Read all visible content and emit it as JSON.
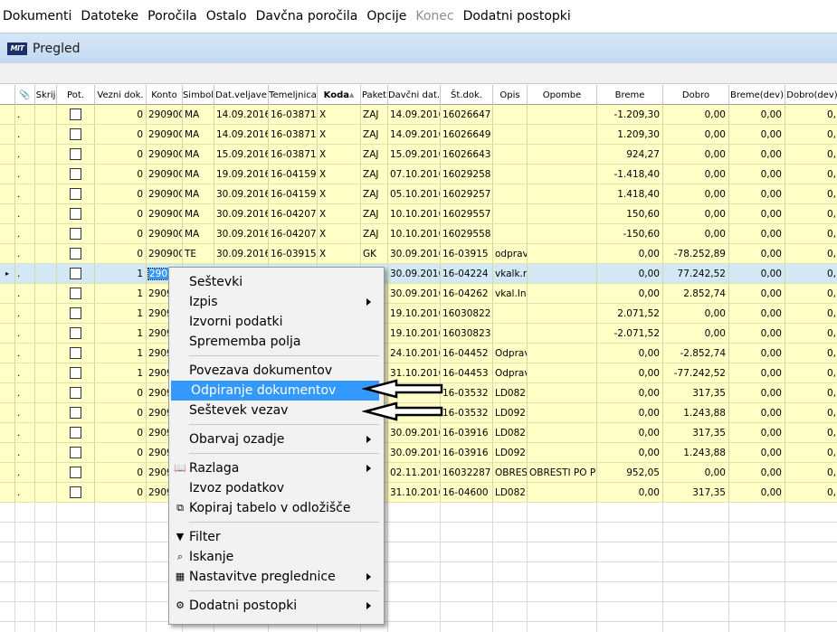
{
  "menubar": {
    "items": [
      {
        "label": "Dokumenti",
        "disabled": false
      },
      {
        "label": "Datoteke",
        "disabled": false
      },
      {
        "label": "Poročila",
        "disabled": false
      },
      {
        "label": "Ostalo",
        "disabled": false
      },
      {
        "label": "Davčna poročila",
        "disabled": false
      },
      {
        "label": "Opcije",
        "disabled": false
      },
      {
        "label": "Konec",
        "disabled": true
      },
      {
        "label": "Dodatni postopki",
        "disabled": false
      }
    ]
  },
  "window": {
    "logo_text": "MIT",
    "title": "Pregled"
  },
  "grid": {
    "columns": [
      "",
      "",
      "Skrij",
      "Pot.",
      "Vezni dok.",
      "Konto",
      "Simbol",
      "Dat.veljave",
      "Temeljnica",
      "Koda",
      "Paket",
      "Davčni dat.",
      "Št.dok.",
      "Opis",
      "Opombe",
      "Breme",
      "Dobro",
      "Breme(dev)",
      "Dobro(dev)"
    ],
    "sort_column": "Koda",
    "rows": [
      {
        "mark": ".",
        "vezni": "0",
        "konto": "290900",
        "simbol": "MA",
        "datv": "14.09.2016",
        "temeljnica": "16-03871",
        "koda": "X",
        "paket": "ZAJ",
        "davdat": "14.09.2016",
        "stdok": "16026647",
        "opis": "",
        "opombe": "",
        "breme": "-1.209,30",
        "dobro": "0,00",
        "bremedev": "0,00",
        "dobrodev": "0,"
      },
      {
        "mark": ".",
        "vezni": "0",
        "konto": "290900",
        "simbol": "MA",
        "datv": "14.09.2016",
        "temeljnica": "16-03871",
        "koda": "X",
        "paket": "ZAJ",
        "davdat": "14.09.2016",
        "stdok": "16026649",
        "opis": "",
        "opombe": "",
        "breme": "1.209,30",
        "dobro": "0,00",
        "bremedev": "0,00",
        "dobrodev": "0,"
      },
      {
        "mark": ".",
        "vezni": "0",
        "konto": "290900",
        "simbol": "MA",
        "datv": "15.09.2016",
        "temeljnica": "16-03871",
        "koda": "X",
        "paket": "ZAJ",
        "davdat": "15.09.2016",
        "stdok": "16026643",
        "opis": "",
        "opombe": "",
        "breme": "924,27",
        "dobro": "0,00",
        "bremedev": "0,00",
        "dobrodev": "0,"
      },
      {
        "mark": ".",
        "vezni": "0",
        "konto": "290900",
        "simbol": "MA",
        "datv": "19.09.2016",
        "temeljnica": "16-04159",
        "koda": "X",
        "paket": "ZAJ",
        "davdat": "07.10.2016",
        "stdok": "16029258",
        "opis": "",
        "opombe": "",
        "breme": "-1.418,40",
        "dobro": "0,00",
        "bremedev": "0,00",
        "dobrodev": "0,"
      },
      {
        "mark": ".",
        "vezni": "0",
        "konto": "290900",
        "simbol": "MA",
        "datv": "30.09.2016",
        "temeljnica": "16-04159",
        "koda": "X",
        "paket": "ZAJ",
        "davdat": "05.10.2016",
        "stdok": "16029257",
        "opis": "",
        "opombe": "",
        "breme": "1.418,40",
        "dobro": "0,00",
        "bremedev": "0,00",
        "dobrodev": "0,"
      },
      {
        "mark": ".",
        "vezni": "0",
        "konto": "290900",
        "simbol": "MA",
        "datv": "30.09.2016",
        "temeljnica": "16-04207",
        "koda": "X",
        "paket": "ZAJ",
        "davdat": "10.10.2016",
        "stdok": "16029557",
        "opis": "",
        "opombe": "",
        "breme": "150,60",
        "dobro": "0,00",
        "bremedev": "0,00",
        "dobrodev": "0,"
      },
      {
        "mark": ".",
        "vezni": "0",
        "konto": "290900",
        "simbol": "MA",
        "datv": "30.09.2016",
        "temeljnica": "16-04207",
        "koda": "X",
        "paket": "ZAJ",
        "davdat": "10.10.2016",
        "stdok": "16029558",
        "opis": "",
        "opombe": "",
        "breme": "-150,60",
        "dobro": "0,00",
        "bremedev": "0,00",
        "dobrodev": "0,"
      },
      {
        "mark": ".",
        "vezni": "0",
        "konto": "290900",
        "simbol": "TE",
        "datv": "30.09.2016",
        "temeljnica": "16-03915",
        "koda": "X",
        "paket": "GK",
        "davdat": "30.09.2016",
        "stdok": "16-03915",
        "opis": "odprav",
        "opombe": "",
        "breme": "0,00",
        "dobro": "-78.252,89",
        "bremedev": "0,00",
        "dobrodev": "0,"
      },
      {
        "mark": ".",
        "vezni": "1",
        "konto": "2909",
        "simbol": "",
        "datv": "",
        "temeljnica": "",
        "koda": "",
        "paket": "",
        "davdat": "30.09.2016",
        "stdok": "16-04224",
        "opis": "vkalk.r",
        "opombe": "",
        "breme": "0,00",
        "dobro": "77.242,52",
        "bremedev": "0,00",
        "dobrodev": "0,"
      },
      {
        "mark": ".",
        "vezni": "1",
        "konto": "2909",
        "simbol": "",
        "datv": "",
        "temeljnica": "",
        "koda": "",
        "paket": "",
        "davdat": "30.09.2016",
        "stdok": "16-04262",
        "opis": "vkal.In",
        "opombe": "",
        "breme": "0,00",
        "dobro": "2.852,74",
        "bremedev": "0,00",
        "dobrodev": "0,"
      },
      {
        "mark": ".",
        "vezni": "1",
        "konto": "2909",
        "simbol": "",
        "datv": "",
        "temeljnica": "",
        "koda": "",
        "paket": "",
        "davdat": "19.10.2016",
        "stdok": "16030822",
        "opis": "",
        "opombe": "",
        "breme": "2.071,52",
        "dobro": "0,00",
        "bremedev": "0,00",
        "dobrodev": "0,"
      },
      {
        "mark": ".",
        "vezni": "1",
        "konto": "2909",
        "simbol": "",
        "datv": "",
        "temeljnica": "",
        "koda": "",
        "paket": "",
        "davdat": "19.10.2016",
        "stdok": "16030823",
        "opis": "",
        "opombe": "",
        "breme": "-2.071,52",
        "dobro": "0,00",
        "bremedev": "0,00",
        "dobrodev": "0,"
      },
      {
        "mark": ".",
        "vezni": "1",
        "konto": "2909",
        "simbol": "",
        "datv": "",
        "temeljnica": "",
        "koda": "",
        "paket": "",
        "davdat": "24.10.2016",
        "stdok": "16-04452",
        "opis": "Odprav",
        "opombe": "",
        "breme": "0,00",
        "dobro": "-2.852,74",
        "bremedev": "0,00",
        "dobrodev": "0,"
      },
      {
        "mark": ".",
        "vezni": "1",
        "konto": "2909",
        "simbol": "",
        "datv": "",
        "temeljnica": "",
        "koda": "",
        "paket": "",
        "davdat": "31.10.2016",
        "stdok": "16-04453",
        "opis": "Odprav",
        "opombe": "",
        "breme": "0,00",
        "dobro": "-77.242,52",
        "bremedev": "0,00",
        "dobrodev": "0,"
      },
      {
        "mark": ".",
        "vezni": "0",
        "konto": "2909",
        "simbol": "",
        "datv": "",
        "temeljnica": "",
        "koda": "",
        "paket": "",
        "davdat": "",
        "stdok": "16-03532",
        "opis": "LD082",
        "opombe": "",
        "breme": "0,00",
        "dobro": "317,35",
        "bremedev": "0,00",
        "dobrodev": "0,"
      },
      {
        "mark": ".",
        "vezni": "0",
        "konto": "2909",
        "simbol": "",
        "datv": "",
        "temeljnica": "",
        "koda": "",
        "paket": "",
        "davdat": "",
        "stdok": "16-03532",
        "opis": "LD092",
        "opombe": "",
        "breme": "0,00",
        "dobro": "1.243,88",
        "bremedev": "0,00",
        "dobrodev": "0,"
      },
      {
        "mark": ".",
        "vezni": "0",
        "konto": "2909",
        "simbol": "",
        "datv": "",
        "temeljnica": "",
        "koda": "",
        "paket": "",
        "davdat": "30.09.2016",
        "stdok": "16-03916",
        "opis": "LD082",
        "opombe": "",
        "breme": "0,00",
        "dobro": "317,35",
        "bremedev": "0,00",
        "dobrodev": "0,"
      },
      {
        "mark": ".",
        "vezni": "0",
        "konto": "2909",
        "simbol": "",
        "datv": "",
        "temeljnica": "",
        "koda": "",
        "paket": "",
        "davdat": "30.09.2016",
        "stdok": "16-03916",
        "opis": "LD092",
        "opombe": "",
        "breme": "0,00",
        "dobro": "1.243,88",
        "bremedev": "0,00",
        "dobrodev": "0,"
      },
      {
        "mark": ".",
        "vezni": "0",
        "konto": "2909",
        "simbol": "",
        "datv": "",
        "temeljnica": "",
        "koda": "",
        "paket": "",
        "davdat": "02.11.2016",
        "stdok": "16032287",
        "opis": "OBRES",
        "opombe": "OBRESTI PO P",
        "breme": "952,05",
        "dobro": "0,00",
        "bremedev": "0,00",
        "dobrodev": "0,"
      },
      {
        "mark": ".",
        "vezni": "0",
        "konto": "2909",
        "simbol": "",
        "datv": "",
        "temeljnica": "",
        "koda": "",
        "paket": "",
        "davdat": "31.10.2016",
        "stdok": "16-04600",
        "opis": "LD082",
        "opombe": "",
        "breme": "0,00",
        "dobro": "317,35",
        "bremedev": "0,00",
        "dobrodev": "0,"
      }
    ],
    "selected_row": 8,
    "selected_konto_text": "290",
    "empty_rows": 7
  },
  "context_menu": {
    "items": [
      {
        "type": "item",
        "label": "Seštevki",
        "submenu": false,
        "icon": ""
      },
      {
        "type": "item",
        "label": "Izpis",
        "submenu": true,
        "icon": ""
      },
      {
        "type": "item",
        "label": "Izvorni podatki",
        "submenu": false,
        "icon": ""
      },
      {
        "type": "item",
        "label": "Sprememba polja",
        "submenu": false,
        "icon": ""
      },
      {
        "type": "sep"
      },
      {
        "type": "item",
        "label": "Povezava dokumentov",
        "submenu": false,
        "icon": ""
      },
      {
        "type": "item",
        "label": "Odpiranje dokumentov",
        "submenu": false,
        "icon": "",
        "highlight": true
      },
      {
        "type": "item",
        "label": "Seštevek vezav",
        "submenu": false,
        "icon": ""
      },
      {
        "type": "sep"
      },
      {
        "type": "item",
        "label": "Obarvaj ozadje",
        "submenu": true,
        "icon": ""
      },
      {
        "type": "sep"
      },
      {
        "type": "item",
        "label": "Razlaga",
        "submenu": true,
        "icon": "help-book-icon"
      },
      {
        "type": "item",
        "label": "Izvoz podatkov",
        "submenu": false,
        "icon": ""
      },
      {
        "type": "item",
        "label": "Kopiraj tabelo v odložišče",
        "submenu": false,
        "icon": "copy-table-icon"
      },
      {
        "type": "sep"
      },
      {
        "type": "item",
        "label": "Filter",
        "submenu": false,
        "icon": "filter-icon"
      },
      {
        "type": "item",
        "label": "Iskanje",
        "submenu": false,
        "icon": "magnifier-icon"
      },
      {
        "type": "item",
        "label": "Nastavitve preglednice",
        "submenu": true,
        "icon": "settings-icon"
      },
      {
        "type": "sep"
      },
      {
        "type": "item",
        "label": "Dodatni postopki",
        "submenu": true,
        "icon": "extra-procedures-icon"
      }
    ]
  },
  "colors": {
    "row_yellow": "#ffffc6",
    "selected_row": "#d2e8f4",
    "menu_highlight": "#3399ff",
    "title_gradient": "#c3d9f0"
  }
}
